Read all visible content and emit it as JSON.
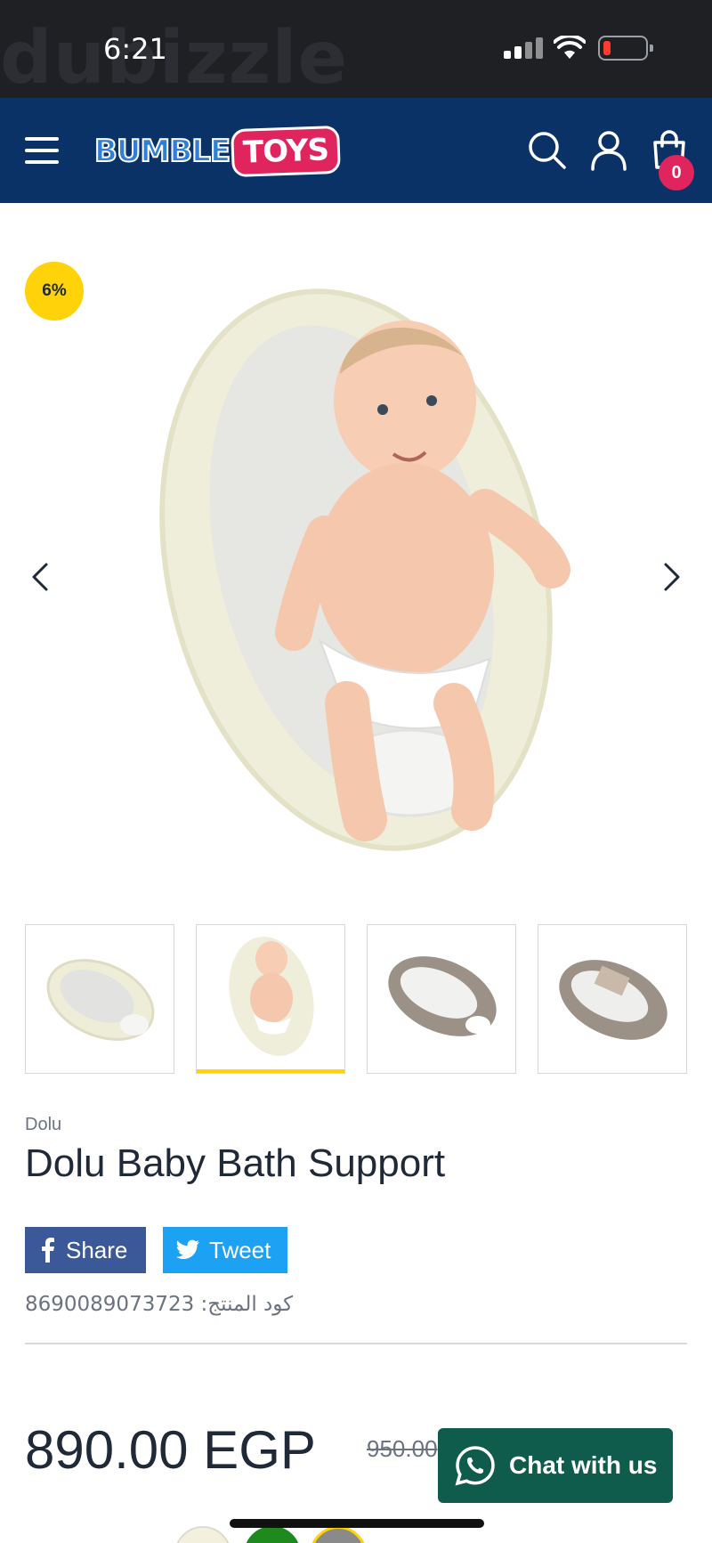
{
  "status_bar": {
    "time": "6:21",
    "watermark": "dubizzle"
  },
  "header": {
    "logo_part1": "BUMBLE",
    "logo_part2": "TOYS",
    "cart_count": "0"
  },
  "gallery": {
    "discount_badge": "6%",
    "thumbnails_count": 4,
    "active_thumbnail": 2
  },
  "product": {
    "brand": "Dolu",
    "title": "Dolu Baby Bath Support",
    "share_label": "Share",
    "tweet_label": "Tweet",
    "sku_text": "كود المنتج: 8690089073723",
    "price": "890.00 EGP",
    "old_price": "950.00"
  },
  "chat": {
    "label": "Chat with us"
  },
  "colors": {
    "header_bg": "#0b3266",
    "badge_yellow": "#ffd20a",
    "cart_badge": "#e0245e",
    "facebook": "#3b5998",
    "twitter": "#1da1f2",
    "whatsapp_button": "#0f5c4d",
    "swatches": [
      "#f3f1de",
      "#1e8a1e",
      "#8a8a8a"
    ]
  }
}
